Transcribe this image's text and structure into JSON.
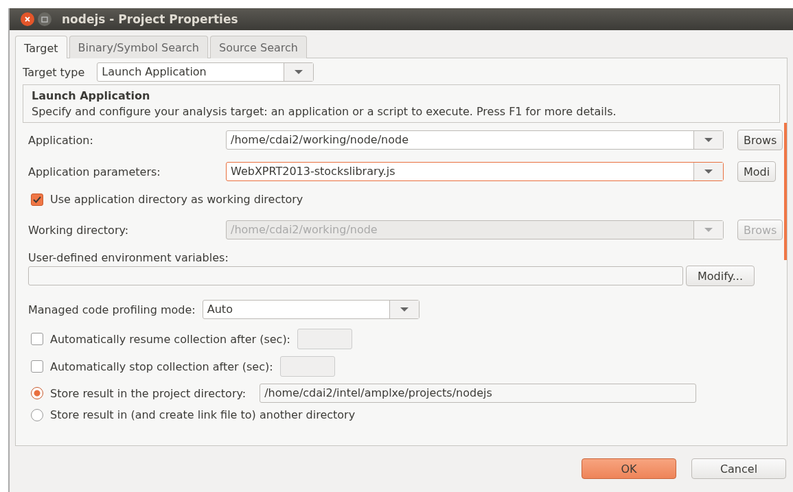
{
  "window": {
    "title": "nodejs - Project Properties"
  },
  "tabs": [
    {
      "label": "Target",
      "selected": true
    },
    {
      "label": "Binary/Symbol Search",
      "selected": false
    },
    {
      "label": "Source Search",
      "selected": false
    }
  ],
  "target_type": {
    "label": "Target type",
    "value": "Launch Application"
  },
  "section": {
    "title": "Launch Application",
    "description": "Specify and configure your analysis target: an application or a script to execute. Press F1 for more details."
  },
  "fields": [
    {
      "label": "Application:",
      "value": "/home/cdai2/working/node/node",
      "button": "Brows",
      "disabled": false,
      "focused": false
    },
    {
      "label": "Application parameters:",
      "value": "WebXPRT2013-stockslibrary.js",
      "button": "Modi",
      "disabled": false,
      "focused": true
    }
  ],
  "use_app_dir": {
    "label": "Use application directory as working directory",
    "checked": true
  },
  "working_dir": {
    "label": "Working directory:",
    "value": "/home/cdai2/working/node",
    "button": "Brows",
    "disabled": true,
    "focused": false
  },
  "env": {
    "label": "User-defined environment variables:",
    "button": "Modify..."
  },
  "profiling_mode": {
    "label": "Managed code profiling mode:",
    "value": "Auto"
  },
  "options": [
    {
      "label": "Automatically resume collection after (sec):",
      "checked": false
    },
    {
      "label": "Automatically stop collection after (sec):",
      "checked": false
    }
  ],
  "result_location": [
    {
      "label": "Store result in the project directory:",
      "selected": true,
      "value": "/home/cdai2/intel/amplxe/projects/nodejs"
    },
    {
      "label": "Store result in (and create link file to) another directory",
      "selected": false
    }
  ],
  "buttons": [
    {
      "label": "OK",
      "primary": true
    },
    {
      "label": "Cancel",
      "primary": false
    }
  ]
}
